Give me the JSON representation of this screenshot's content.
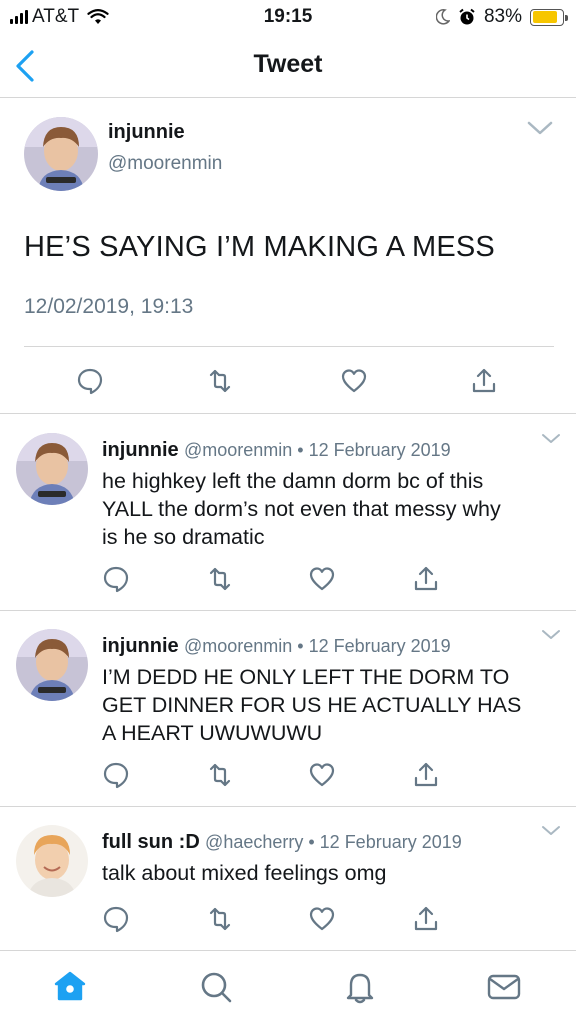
{
  "status_bar": {
    "carrier": "AT&T",
    "time": "19:15",
    "battery_percent": "83%",
    "battery_level": 0.83,
    "icons": [
      "signal-icon",
      "wifi-icon",
      "moon-icon",
      "alarm-icon",
      "battery-icon"
    ]
  },
  "nav": {
    "title": "Tweet",
    "back_icon": "chevron-left-icon",
    "accent_color": "#1da1f2"
  },
  "main_tweet": {
    "name": "injunnie",
    "handle": "@moorenmin",
    "text": "HE’S SAYING I’M MAKING A MESS",
    "date": "12/02/2019, 19:13"
  },
  "replies": [
    {
      "name": "injunnie",
      "meta": "@moorenmin • 12 February 2019",
      "lines": [
        "he highkey left the damn dorm bc of this",
        "YALL the dorm’s not even that messy why",
        "is he so dramatic"
      ]
    },
    {
      "name": "injunnie",
      "meta": "@moorenmin • 12 February 2019",
      "lines": [
        "I’M DEDD HE ONLY LEFT THE DORM TO",
        "GET DINNER FOR US HE ACTUALLY HAS",
        "A HEART UWUWUWU"
      ]
    },
    {
      "name": "full sun :D",
      "meta": "@haecherry • 12 February 2019",
      "lines": [
        "talk about mixed feelings omg"
      ]
    }
  ],
  "tabs": [
    "home-icon",
    "search-icon",
    "notifications-icon",
    "messages-icon"
  ],
  "colors": {
    "secondary_text": "#657786",
    "icon_gray": "#657786",
    "battery_yellow": "#f7c600"
  }
}
